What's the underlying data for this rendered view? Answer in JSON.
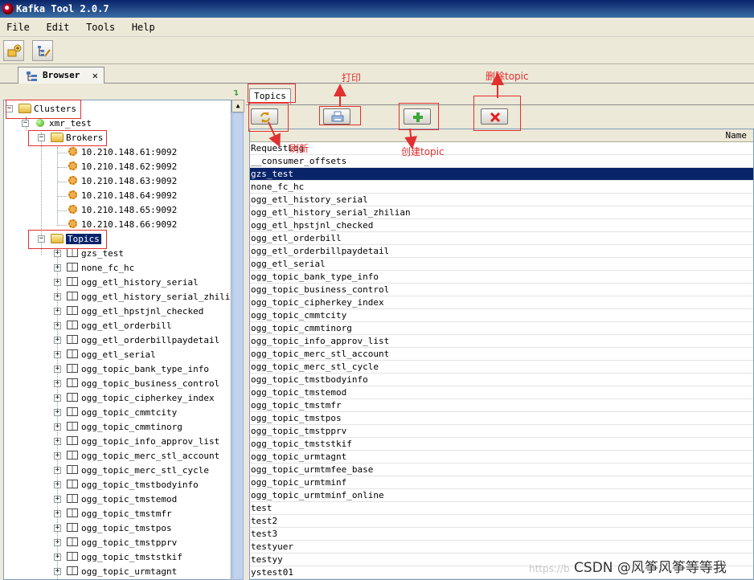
{
  "window": {
    "title": "Kafka Tool  2.0.7"
  },
  "menu": [
    "File",
    "Edit",
    "Tools",
    "Help"
  ],
  "tabs": {
    "browser_label": "Browser",
    "close_glyph": "✕"
  },
  "tree": {
    "root": "Clusters",
    "cluster": "xmr_test",
    "brokers_label": "Brokers",
    "brokers": [
      "10.210.148.61:9092",
      "10.210.148.62:9092",
      "10.210.148.63:9092",
      "10.210.148.64:9092",
      "10.210.148.65:9092",
      "10.210.148.66:9092"
    ],
    "topics_label": "Topics",
    "topics": [
      "gzs_test",
      "none_fc_hc",
      "ogg_etl_history_serial",
      "ogg_etl_history_serial_zhilian",
      "ogg_etl_hpstjnl_checked",
      "ogg_etl_orderbill",
      "ogg_etl_orderbillpaydetail",
      "ogg_etl_serial",
      "ogg_topic_bank_type_info",
      "ogg_topic_business_control",
      "ogg_topic_cipherkey_index",
      "ogg_topic_cmmtcity",
      "ogg_topic_cmmtinorg",
      "ogg_topic_info_approv_list",
      "ogg_topic_merc_stl_account",
      "ogg_topic_merc_stl_cycle",
      "ogg_topic_tmstbodyinfo",
      "ogg_topic_tmstemod",
      "ogg_topic_tmstmfr",
      "ogg_topic_tmstpos",
      "ogg_topic_tmstpprv",
      "ogg_topic_tmststkif",
      "ogg_topic_urmtagnt"
    ]
  },
  "topics_panel": {
    "tab_label": "Topics",
    "column_header": "Name",
    "rows": [
      "RequestLog",
      "__consumer_offsets",
      "gzs_test",
      "none_fc_hc",
      "ogg_etl_history_serial",
      "ogg_etl_history_serial_zhilian",
      "ogg_etl_hpstjnl_checked",
      "ogg_etl_orderbill",
      "ogg_etl_orderbillpaydetail",
      "ogg_etl_serial",
      "ogg_topic_bank_type_info",
      "ogg_topic_business_control",
      "ogg_topic_cipherkey_index",
      "ogg_topic_cmmtcity",
      "ogg_topic_cmmtinorg",
      "ogg_topic_info_approv_list",
      "ogg_topic_merc_stl_account",
      "ogg_topic_merc_stl_cycle",
      "ogg_topic_tmstbodyinfo",
      "ogg_topic_tmstemod",
      "ogg_topic_tmstmfr",
      "ogg_topic_tmstpos",
      "ogg_topic_tmstpprv",
      "ogg_topic_tmststkif",
      "ogg_topic_urmtagnt",
      "ogg_topic_urmtmfee_base",
      "ogg_topic_urmtminf",
      "ogg_topic_urmtminf_online",
      "test",
      "test2",
      "test3",
      "testyuer",
      "testyy",
      "ystest01"
    ],
    "selected_index": 2
  },
  "annotations": {
    "refresh": "刷新",
    "print": "打印",
    "create_topic": "创建topic",
    "delete_topic": "删除topic"
  },
  "watermark": {
    "faint": "https://b",
    "main": "CSDN @风筝风筝等等我"
  },
  "colors": {
    "annotation": "#e03030",
    "selection": "#0a246a"
  }
}
